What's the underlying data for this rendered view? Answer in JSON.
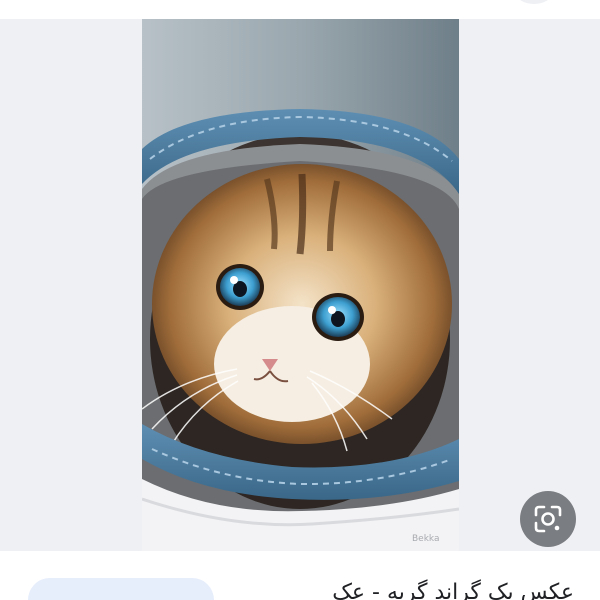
{
  "image_result": {
    "caption": "عکس بک گراند گربه - عک",
    "photo_subject": "kitten-in-denim-photo",
    "watermark": "Bekka"
  },
  "actions": {
    "lens_icon": "google-lens-icon",
    "visit_button_label": ""
  },
  "colors": {
    "preview_background": "#eff0f4",
    "lens_button": "#585c60",
    "pill": "#e6edfb"
  }
}
